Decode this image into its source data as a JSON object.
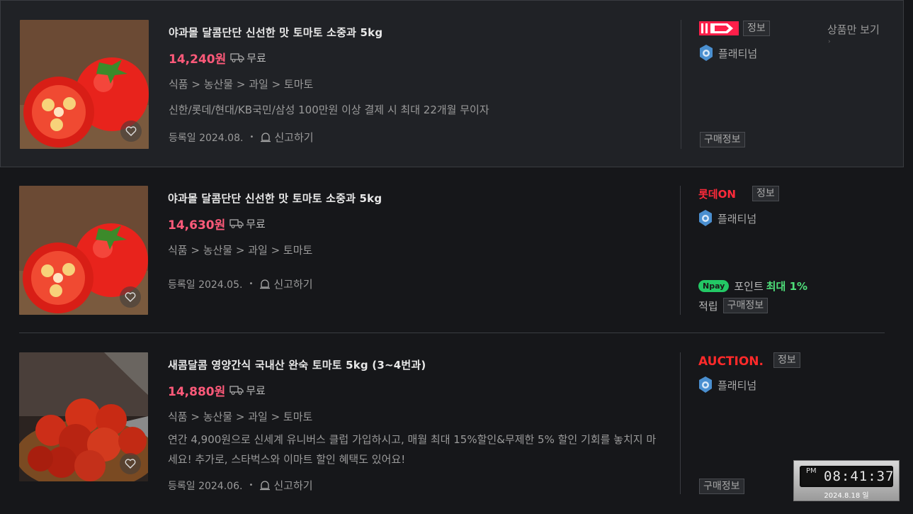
{
  "header": {
    "view_products_only": "상품만 보기"
  },
  "products": [
    {
      "title": "야과몰 달콤단단 신선한 맛 토마토 소중과 5kg",
      "price": "14,240원",
      "shipping": "무료",
      "category": "식품 > 농산물 > 과일 > 토마토",
      "description": "신한/롯데/현대/KB국민/삼성 100만원 이상 결제 시 최대 22개월 무이자",
      "reg_date": "등록일 2024.08.",
      "report": "신고하기",
      "mall_logo": "11번가",
      "info_tag": "정보",
      "grade": "플래티넘",
      "buy_info": "구매정보"
    },
    {
      "title": "야과몰 달콤단단 신선한 맛 토마토 소중과 5kg",
      "price": "14,630원",
      "shipping": "무료",
      "category": "식품 > 농산물 > 과일 > 토마토",
      "reg_date": "등록일 2024.05.",
      "report": "신고하기",
      "mall_logo": "롯데ON",
      "info_tag": "정보",
      "grade": "플래티넘",
      "npay_badge": "Npay",
      "point_label": "포인트",
      "point_max": "최대 1%",
      "accumulate": "적립",
      "buy_info": "구매정보"
    },
    {
      "title": "새콤달콤 영양간식 국내산 완숙 토마토 5kg (3~4번과)",
      "price": "14,880원",
      "shipping": "무료",
      "category": "식품 > 농산물 > 과일 > 토마토",
      "description": "연간 4,900원으로 신세계 유니버스 클럽 가입하시고, 매월 최대 15%할인&무제한 5% 할인 기회를 놓치지 마세요! 추가로, 스타벅스와 이마트 할인 혜택도 있어요!",
      "reg_date": "등록일 2024.06.",
      "report": "신고하기",
      "mall_logo": "AUCTION.",
      "info_tag": "정보",
      "grade": "플래티넘",
      "buy_info": "구매정보"
    }
  ],
  "clock": {
    "ampm": "PM",
    "time": "08:41:37",
    "date": "2024.8.18 일"
  },
  "colors": {
    "price": "#ff5a7a",
    "npay": "#23c865",
    "point_max": "#4fe07a"
  }
}
